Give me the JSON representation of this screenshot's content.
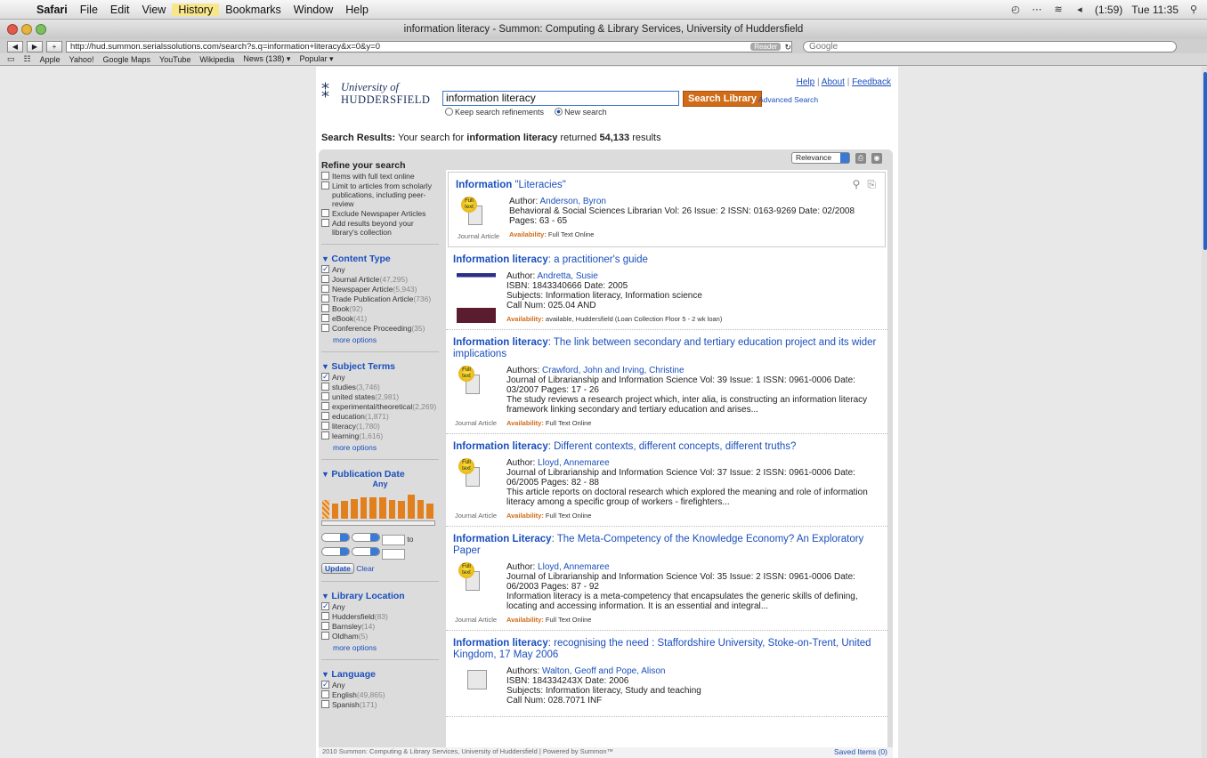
{
  "menubar": {
    "items": [
      "Safari",
      "File",
      "Edit",
      "View",
      "History",
      "Bookmarks",
      "Window",
      "Help"
    ],
    "battery": "(1:59)",
    "clock": "Tue 11:35"
  },
  "window": {
    "title": "information literacy - Summon: Computing & Library Services, University of Huddersfield"
  },
  "toolbar": {
    "url": "http://hud.summon.serialssolutions.com/search?s.q=information+literacy&x=0&y=0",
    "reader_label": "Reader",
    "search_placeholder": "Google"
  },
  "bookmarks": [
    "Apple",
    "Yahoo!",
    "Google Maps",
    "YouTube",
    "Wikipedia",
    "News (138) ▾",
    "Popular ▾"
  ],
  "header": {
    "logo_line1": "University of",
    "logo_line2": "HUDDERSFIELD",
    "links": [
      "Help",
      "About",
      "Feedback"
    ],
    "search_value": "information literacy",
    "search_button": "Search Library",
    "advanced": "Advanced Search",
    "radio_keep": "Keep search refinements",
    "radio_new": "New search"
  },
  "summary": {
    "label": "Search Results:",
    "prefix": "Your search for",
    "query": "information literacy",
    "middle": "returned",
    "count": "54,133",
    "suffix": "results"
  },
  "sidebar": {
    "refine_title": "Refine your search",
    "refine_items": [
      "Items with full text online",
      "Limit to articles from scholarly publications, including peer-review",
      "Exclude Newspaper Articles",
      "Add results beyond your library's collection"
    ],
    "content_type": {
      "title": "Content Type",
      "items": [
        [
          "Any",
          ""
        ],
        [
          "Journal Article",
          "(47,295)"
        ],
        [
          "Newspaper Article",
          "(5,943)"
        ],
        [
          "Trade Publication Article",
          "(736)"
        ],
        [
          "Book",
          "(92)"
        ],
        [
          "eBook",
          "(41)"
        ],
        [
          "Conference Proceeding",
          "(35)"
        ]
      ],
      "more": "more options"
    },
    "subject_terms": {
      "title": "Subject Terms",
      "items": [
        [
          "Any",
          ""
        ],
        [
          "studies",
          "(3,746)"
        ],
        [
          "united states",
          "(2,981)"
        ],
        [
          "experimental/theoretical",
          "(2,269)"
        ],
        [
          "education",
          "(1,871)"
        ],
        [
          "literacy",
          "(1,780)"
        ],
        [
          "learning",
          "(1,616)"
        ]
      ],
      "more": "more options"
    },
    "pub_date": {
      "title": "Publication Date",
      "value": "Any",
      "to": "to",
      "update": "Update",
      "clear": "Clear",
      "bar_levels": [
        0.75,
        0.6,
        0.7,
        0.8,
        0.85,
        0.85,
        0.85,
        0.75,
        0.7,
        0.95,
        0.75,
        0.6
      ]
    },
    "location": {
      "title": "Library Location",
      "items": [
        [
          "Any",
          ""
        ],
        [
          "Huddersfield",
          "(83)"
        ],
        [
          "Barnsley",
          "(14)"
        ],
        [
          "Oldham",
          "(5)"
        ]
      ],
      "more": "more options"
    },
    "language": {
      "title": "Language",
      "items": [
        [
          "Any",
          ""
        ],
        [
          "English",
          "(49,865)"
        ],
        [
          "Spanish",
          "(171)"
        ]
      ]
    }
  },
  "sort": {
    "label": "Relevance"
  },
  "results": [
    {
      "title_bold": "Information",
      "title_rest": " \"Literacies\"",
      "author_label": "Author:",
      "author": "Anderson, Byron",
      "line2": "Behavioral & Social Sciences Librarian Vol: 26 Issue: 2 ISSN: 0163-9269 Date: 02/2008",
      "line3": "Pages: 63 - 65",
      "avail_label": "Availability:",
      "avail": "Full Text Online",
      "type": "Journal Article",
      "fulltext": true
    },
    {
      "title_bold": "Information literacy",
      "title_rest": ": a practitioner's guide",
      "author_label": "Author:",
      "author": "Andretta, Susie",
      "line2": "ISBN: 1843340666 Date: 2005",
      "line3": "Subjects: Information literacy, Information science",
      "line4": "Call Num: 025.04 AND",
      "avail_label": "Availability:",
      "avail": "available, Huddersfield (Loan Collection Floor 5 - 2 wk loan)",
      "type": "",
      "book": true
    },
    {
      "title_bold": "Information literacy",
      "title_rest": ": The link between secondary and tertiary education project and its wider implications",
      "author_label": "Authors:",
      "author": "Crawford, John and Irving, Christine",
      "line2": "Journal of Librarianship and Information Science Vol: 39 Issue: 1 ISSN: 0961-0006 Date: 03/2007 Pages: 17 - 26",
      "line3": "The study reviews a research project which, inter alia, is constructing an information literacy framework linking secondary and tertiary education and arises...",
      "avail_label": "Availability:",
      "avail": "Full Text Online",
      "type": "Journal Article",
      "fulltext": true
    },
    {
      "title_bold": "Information literacy",
      "title_rest": ": Different contexts, different concepts, different truths?",
      "author_label": "Author:",
      "author": "Lloyd, Annemaree",
      "line2": "Journal of Librarianship and Information Science Vol: 37 Issue: 2 ISSN: 0961-0006 Date: 06/2005 Pages: 82 - 88",
      "line3": "This article reports on doctoral research which explored the meaning and role of information literacy among a specific group of workers - firefighters...",
      "avail_label": "Availability:",
      "avail": "Full Text Online",
      "type": "Journal Article",
      "fulltext": true
    },
    {
      "title_bold": "Information Literacy",
      "title_rest": ": The Meta-Competency of the Knowledge Economy? An Exploratory Paper",
      "author_label": "Author:",
      "author": "Lloyd, Annemaree",
      "line2": "Journal of Librarianship and Information Science Vol: 35 Issue: 2 ISSN: 0961-0006 Date: 06/2003 Pages: 87 - 92",
      "line3": "Information literacy is a meta-competency that encapsulates the generic skills of defining, locating and accessing information. It is an essential and integral...",
      "avail_label": "Availability:",
      "avail": "Full Text Online",
      "type": "Journal Article",
      "fulltext": true
    },
    {
      "title_bold": "Information literacy",
      "title_rest": ": recognising the need : Staffordshire University, Stoke-on-Trent, United Kingdom, 17 May 2006",
      "author_label": "Authors:",
      "author": "Walton, Geoff and Pope, Alison",
      "line2": "ISBN: 184334243X Date: 2006",
      "line3": "Subjects: Information literacy, Study and teaching",
      "line4": "Call Num: 028.7071 INF",
      "type": ""
    }
  ],
  "footer": {
    "text": "2010 Summon: Computing & Library Services, University of Huddersfield  |  Powered by Summon™",
    "saved": "Saved Items (0)"
  }
}
